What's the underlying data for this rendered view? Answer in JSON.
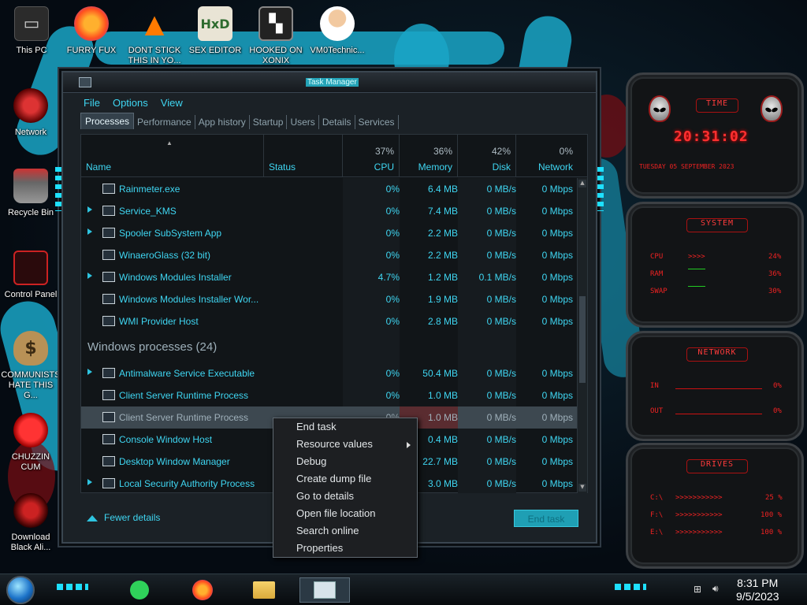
{
  "desktop": {
    "icons": [
      {
        "label": "This PC",
        "icon": "computer-icon"
      },
      {
        "label": "FURRY FUX",
        "icon": "firefox-icon"
      },
      {
        "label": "DONT STICK THIS IN YO...",
        "icon": "vlc-cone-icon"
      },
      {
        "label": "SEX EDITOR",
        "icon": "hxd-editor-icon"
      },
      {
        "label": "HOOKED ON XONIX",
        "icon": "xonix-game-icon"
      },
      {
        "label": "VM0Technic...",
        "icon": "doctor-avatar-icon"
      },
      {
        "label": "Network",
        "icon": "network-icon"
      },
      {
        "label": "Recycle Bin",
        "icon": "recycle-bin-icon"
      },
      {
        "label": "Control Panel",
        "icon": "control-panel-icon"
      },
      {
        "label": "COMMUNISTS HATE THIS G...",
        "icon": "money-bag-icon"
      },
      {
        "label": "CHUZZIN CUM",
        "icon": "chuzzle-icon"
      },
      {
        "label": "Download Black Ali...",
        "icon": "alien-download-icon"
      }
    ]
  },
  "task_manager": {
    "title": "Task Manager",
    "menu": [
      "File",
      "Options",
      "View"
    ],
    "tabs": [
      "Processes",
      "Performance",
      "App history",
      "Startup",
      "Users",
      "Details",
      "Services"
    ],
    "active_tab": "Processes",
    "columns": {
      "name": "Name",
      "status": "Status",
      "cpu": {
        "label": "CPU",
        "pct": "37%"
      },
      "memory": {
        "label": "Memory",
        "pct": "36%"
      },
      "disk": {
        "label": "Disk",
        "pct": "42%"
      },
      "network": {
        "label": "Network",
        "pct": "0%"
      }
    },
    "apps_rows": [
      {
        "name": "Rainmeter.exe",
        "expand": false,
        "icon": "water-drop-icon",
        "cpu": "0%",
        "mem": "6.4 MB",
        "disk": "0 MB/s",
        "net": "0 Mbps"
      },
      {
        "name": "Service_KMS",
        "expand": true,
        "icon": "window-icon",
        "cpu": "0%",
        "mem": "7.4 MB",
        "disk": "0 MB/s",
        "net": "0 Mbps"
      },
      {
        "name": "Spooler SubSystem App",
        "expand": true,
        "icon": "printer-icon",
        "cpu": "0%",
        "mem": "2.2 MB",
        "disk": "0 MB/s",
        "net": "0 Mbps"
      },
      {
        "name": "WinaeroGlass (32 bit)",
        "expand": false,
        "icon": "window-icon",
        "cpu": "0%",
        "mem": "2.2 MB",
        "disk": "0 MB/s",
        "net": "0 Mbps"
      },
      {
        "name": "Windows Modules Installer",
        "expand": true,
        "icon": "window-icon",
        "cpu": "4.7%",
        "mem": "1.2 MB",
        "disk": "0.1 MB/s",
        "net": "0 Mbps"
      },
      {
        "name": "Windows Modules Installer Wor...",
        "expand": false,
        "icon": "window-icon",
        "cpu": "0%",
        "mem": "1.9 MB",
        "disk": "0 MB/s",
        "net": "0 Mbps"
      },
      {
        "name": "WMI Provider Host",
        "expand": false,
        "icon": "wmi-host-icon",
        "cpu": "0%",
        "mem": "2.8 MB",
        "disk": "0 MB/s",
        "net": "0 Mbps"
      }
    ],
    "group_label": "Windows processes (24)",
    "win_rows": [
      {
        "name": "Antimalware Service Executable",
        "expand": true,
        "icon": "window-icon",
        "cpu": "0%",
        "mem": "50.4 MB",
        "disk": "0 MB/s",
        "net": "0 Mbps"
      },
      {
        "name": "Client Server Runtime Process",
        "expand": false,
        "icon": "window-icon",
        "cpu": "0%",
        "mem": "1.0 MB",
        "disk": "0 MB/s",
        "net": "0 Mbps"
      },
      {
        "name": "Client Server Runtime Process",
        "expand": false,
        "icon": "window-icon",
        "cpu": "0%",
        "mem": "1.0 MB",
        "disk": "0 MB/s",
        "net": "0 Mbps",
        "selected": true
      },
      {
        "name": "Console Window Host",
        "expand": false,
        "icon": "console-icon",
        "cpu": "",
        "mem": "0.4 MB",
        "disk": "0 MB/s",
        "net": "0 Mbps"
      },
      {
        "name": "Desktop Window Manager",
        "expand": false,
        "icon": "window-icon",
        "cpu": "",
        "mem": "22.7 MB",
        "disk": "0 MB/s",
        "net": "0 Mbps"
      },
      {
        "name": "Local Security Authority Process",
        "expand": true,
        "icon": "window-icon",
        "cpu": "",
        "mem": "3.0 MB",
        "disk": "0 MB/s",
        "net": "0 Mbps"
      }
    ],
    "fewer_details": "Fewer details",
    "end_task": "End task"
  },
  "context_menu": {
    "items": [
      "End task",
      "Resource values",
      "Debug",
      "Create dump file",
      "Go to details",
      "Open file location",
      "Search online",
      "Properties"
    ],
    "has_submenu": "Resource values"
  },
  "widgets": {
    "time": {
      "header": "TIME",
      "clock": "20:31:02",
      "date": "TUESDAY 05 SEPTEMBER 2023"
    },
    "system": {
      "header": "SYSTEM",
      "cpu_label": "CPU",
      "cpu_value": "24%",
      "ram_label": "RAM",
      "ram_value": "36%",
      "swap_label": "SWAP",
      "swap_value": "30%"
    },
    "network": {
      "header": "NETWORK",
      "in_label": "IN",
      "in_value": "0%",
      "out_label": "OUT",
      "out_value": "0%"
    },
    "drives": {
      "header": "DRIVES",
      "rows": [
        {
          "label": "C:\\",
          "value": "25 %"
        },
        {
          "label": "F:\\",
          "value": "100 %"
        },
        {
          "label": "E:\\",
          "value": "100 %"
        }
      ]
    }
  },
  "taskbar": {
    "pinned": [
      "notes-app-icon",
      "firefox-icon",
      "file-explorer-icon",
      "task-manager-icon"
    ],
    "active": "task-manager-icon",
    "time": "8:31 PM",
    "date": "9/5/2023"
  },
  "colors": {
    "accent": "#3fd6f2",
    "widget_red": "#ff3030",
    "background": "#111518"
  }
}
